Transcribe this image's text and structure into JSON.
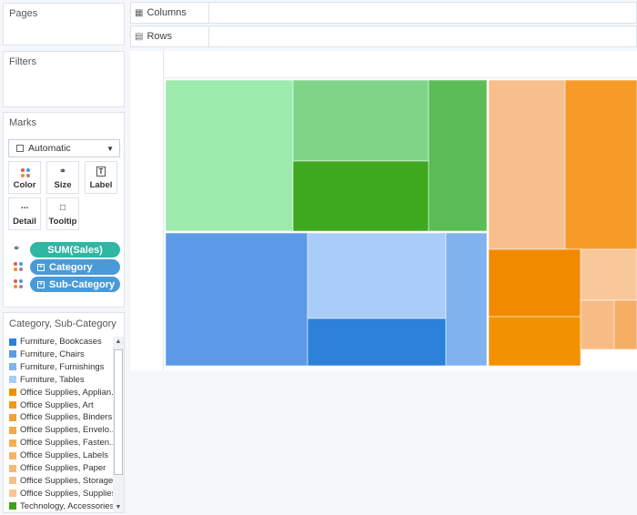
{
  "pages": {
    "title": "Pages"
  },
  "filters": {
    "title": "Filters"
  },
  "marks": {
    "title": "Marks",
    "mark_type": "Automatic",
    "buttons": [
      {
        "label": "Color",
        "icon": "color-icon"
      },
      {
        "label": "Size",
        "icon": "size-icon"
      },
      {
        "label": "Label",
        "icon": "label-icon"
      },
      {
        "label": "Detail",
        "icon": "detail-icon"
      },
      {
        "label": "Tooltip",
        "icon": "tooltip-icon"
      }
    ],
    "pills": [
      {
        "label": "SUM(Sales)",
        "icon": "size-icon",
        "color": "#2fb7a2"
      },
      {
        "label": "Category",
        "icon": "color-icon",
        "color": "#4a9ad8"
      },
      {
        "label": "Sub-Category",
        "icon": "color-icon",
        "color": "#4a9ad8"
      }
    ]
  },
  "shelves": {
    "columns": "Columns",
    "rows": "Rows"
  },
  "legend": {
    "title": "Category, Sub-Category",
    "items": [
      {
        "label": "Furniture, Bookcases",
        "color": "#2c82d9"
      },
      {
        "label": "Furniture, Chairs",
        "color": "#5b9ae6"
      },
      {
        "label": "Furniture, Furnishings",
        "color": "#7fb2ee"
      },
      {
        "label": "Furniture, Tables",
        "color": "#a9ccf8"
      },
      {
        "label": "Office Supplies, Applian..",
        "color": "#f28e00"
      },
      {
        "label": "Office Supplies, Art",
        "color": "#f29a1d"
      },
      {
        "label": "Office Supplies, Binders",
        "color": "#f5a13a"
      },
      {
        "label": "Office Supplies, Envelo..",
        "color": "#f4a94d"
      },
      {
        "label": "Office Supplies, Fasten..",
        "color": "#f3ae5c"
      },
      {
        "label": "Office Supplies, Labels",
        "color": "#f5b46b"
      },
      {
        "label": "Office Supplies, Paper",
        "color": "#f6b978"
      },
      {
        "label": "Office Supplies, Storage",
        "color": "#f7bf84"
      },
      {
        "label": "Office Supplies, Supplies",
        "color": "#f8c694"
      },
      {
        "label": "Technology, Accessories",
        "color": "#3ea21c"
      }
    ]
  },
  "chart_data": {
    "type": "treemap",
    "size_measure": "SUM(Sales)",
    "color_dimension": "Category, Sub-Category",
    "tiles": [
      {
        "category": "Technology",
        "color": "#9deaad"
      },
      {
        "category": "Technology",
        "color": "#80d488"
      },
      {
        "category": "Technology",
        "color": "#3ea91e"
      },
      {
        "category": "Technology",
        "color": "#5cbc56"
      },
      {
        "category": "Furniture",
        "color": "#5b9ae6"
      },
      {
        "category": "Furniture",
        "color": "#a9ccf8"
      },
      {
        "category": "Furniture",
        "color": "#2c82d9"
      },
      {
        "category": "Furniture",
        "color": "#7fb2ee"
      },
      {
        "category": "Office Supplies",
        "color": "#f8bf8d"
      },
      {
        "category": "Office Supplies",
        "color": "#f69b28"
      },
      {
        "category": "Office Supplies",
        "color": "#f28a00"
      },
      {
        "category": "Office Supplies",
        "color": "#f8c79a"
      },
      {
        "category": "Office Supplies",
        "color": "#f6b57a"
      },
      {
        "category": "Office Supplies",
        "color": "#f39200"
      },
      {
        "category": "Office Supplies",
        "color": "#f4a950"
      },
      {
        "category": "Office Supplies",
        "color": "#f7bc86"
      },
      {
        "category": "Office Supplies",
        "color": "#f4ae66"
      }
    ]
  }
}
